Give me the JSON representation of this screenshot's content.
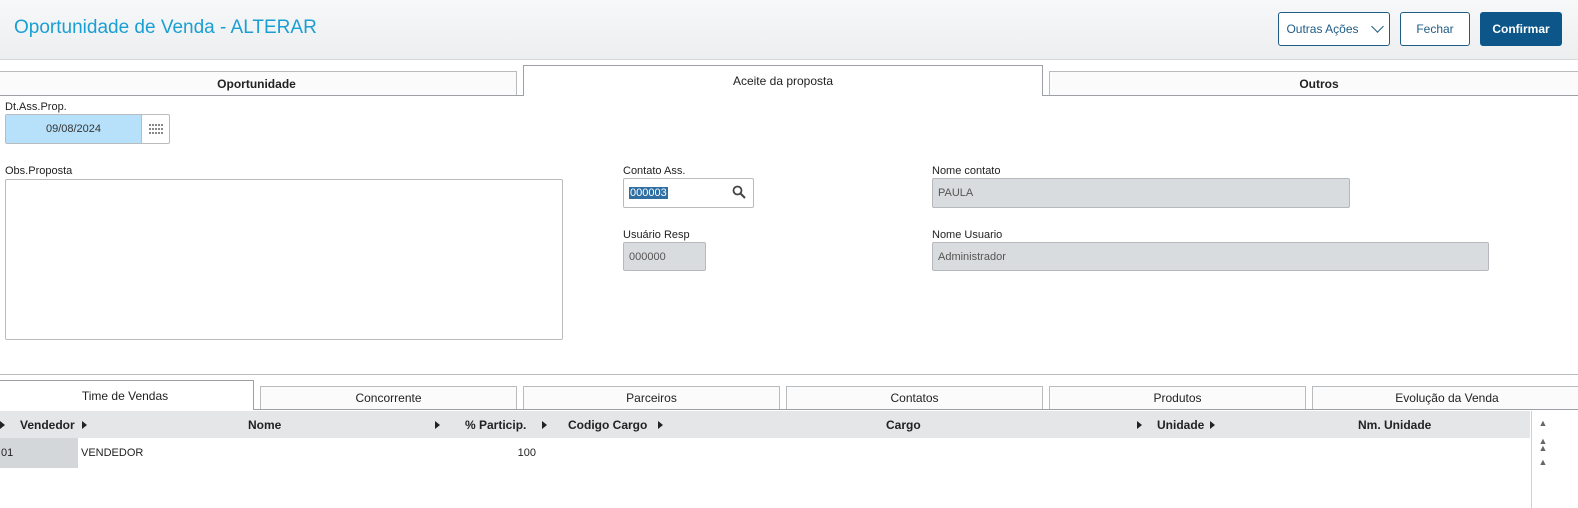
{
  "header": {
    "title": "Oportunidade de Venda - ALTERAR",
    "outras_acoes_label": "Outras Ações",
    "fechar_label": "Fechar",
    "confirmar_label": "Confirmar"
  },
  "top_tabs": {
    "oportunidade": "Oportunidade",
    "aceite": "Aceite da proposta",
    "outros": "Outros",
    "active": "Aceite da proposta"
  },
  "form": {
    "dt_ass_prop_label": "Dt.Ass.Prop.",
    "dt_ass_prop_value": "09/08/2024",
    "obs_proposta_label": "Obs.Proposta",
    "obs_proposta_value": "",
    "contato_ass_label": "Contato Ass.",
    "contato_ass_value": "000003",
    "nome_contato_label": "Nome contato",
    "nome_contato_value": "PAULA",
    "usuario_resp_label": "Usuário Resp",
    "usuario_resp_value": "000000",
    "nome_usuario_label": "Nome Usuario",
    "nome_usuario_value": "Administrador"
  },
  "bottom_tabs": {
    "time_de_vendas": "Time de Vendas",
    "concorrente": "Concorrente",
    "parceiros": "Parceiros",
    "contatos": "Contatos",
    "produtos": "Produtos",
    "evolucao": "Evolução da Venda",
    "active": "Time de Vendas"
  },
  "grid": {
    "columns": {
      "vendedor": "Vendedor",
      "nome": "Nome",
      "particip": "% Particip.",
      "codigo_cargo": "Codigo Cargo",
      "cargo": "Cargo",
      "unidade": "Unidade",
      "nm_unidade": "Nm. Unidade"
    },
    "rows": [
      {
        "vendedor": "01",
        "nome": "VENDEDOR",
        "particip": "100",
        "codigo_cargo": "",
        "cargo": "",
        "unidade": "",
        "nm_unidade": ""
      }
    ]
  },
  "icons": {
    "calendar": "calendar-icon",
    "search": "search-icon",
    "chevron": "chevron-down-icon"
  },
  "colors": {
    "title": "#1a9fd3",
    "primary_button": "#0c5689",
    "date_highlight": "#b7e1fb",
    "selection": "#2f6ea3"
  }
}
